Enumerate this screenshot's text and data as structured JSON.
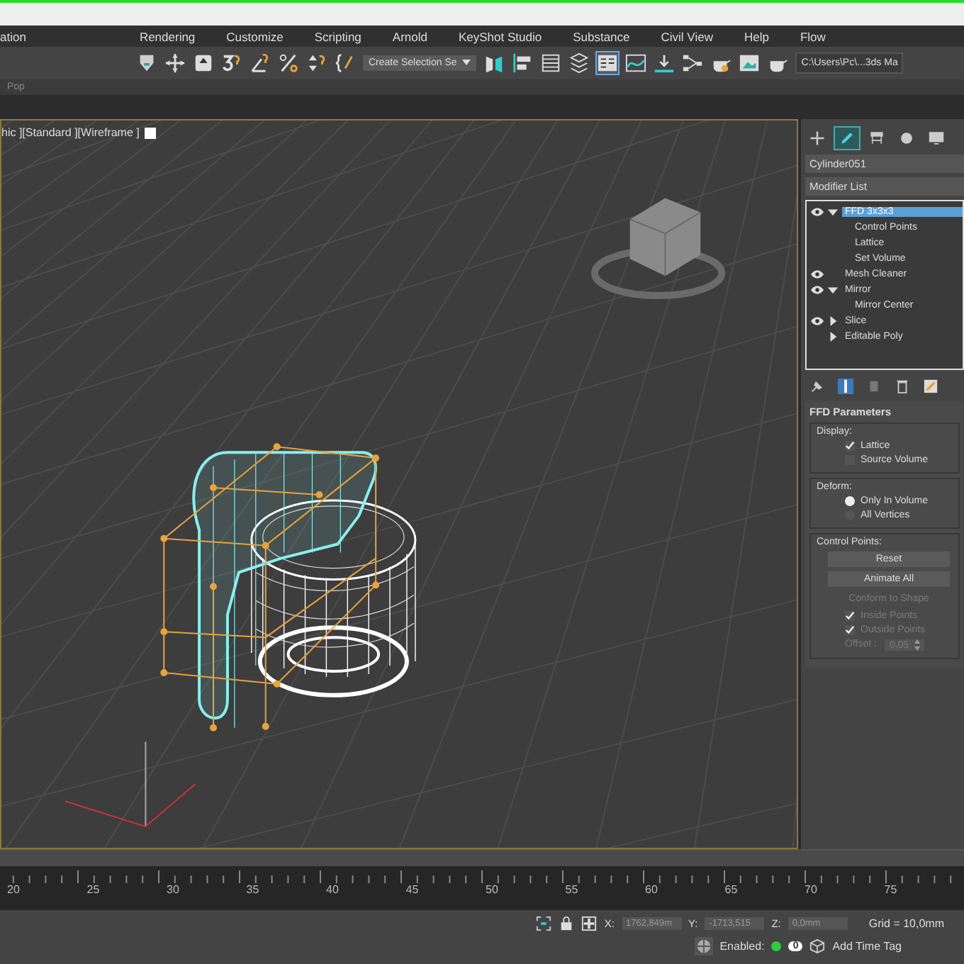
{
  "menu_bar": {
    "items": [
      "ation",
      "Rendering",
      "Customize",
      "Scripting",
      "Arnold",
      "KeyShot Studio",
      "Substance",
      "Civil View",
      "Help",
      "Flow"
    ]
  },
  "toolbar": {
    "selection_set": "Create Selection Se",
    "project_path": "C:\\Users\\Pc\\...3ds Ma"
  },
  "ribbon": {
    "label": "Pop"
  },
  "viewport": {
    "label": "hic ][Standard ][Wireframe ]"
  },
  "command_panel": {
    "tabs": [
      {
        "kind": "create",
        "selected": false
      },
      {
        "kind": "modify",
        "selected": true
      },
      {
        "kind": "hierarchy",
        "selected": false
      },
      {
        "kind": "motion",
        "selected": false
      },
      {
        "kind": "display",
        "selected": false
      }
    ],
    "object_name": "Cylinder051",
    "modifier_list": "Modifier List",
    "stack": [
      {
        "label": "FFD 3x3x3",
        "visible": true,
        "expanded": true,
        "selected": true,
        "children": [
          "Control Points",
          "Lattice",
          "Set Volume"
        ]
      },
      {
        "label": "Mesh Cleaner",
        "visible": true,
        "selected": false
      },
      {
        "label": "Mirror",
        "visible": true,
        "expanded": true,
        "selected": false,
        "children": [
          "Mirror Center"
        ]
      },
      {
        "label": "Slice",
        "visible": true,
        "expanded": false,
        "selected": false
      },
      {
        "label": "Editable Poly",
        "visible": false,
        "expanded": false,
        "selected": false
      }
    ],
    "rollout": {
      "title": "FFD Parameters",
      "groups": [
        {
          "title": "Display:",
          "controls": [
            {
              "kind": "checkbox",
              "label": "Lattice",
              "checked": true
            },
            {
              "kind": "checkbox",
              "label": "Source Volume",
              "checked": false
            }
          ]
        },
        {
          "title": "Deform:",
          "controls": [
            {
              "kind": "radio",
              "label": "Only In Volume",
              "selected": true
            },
            {
              "kind": "radio",
              "label": "All Vertices",
              "selected": false
            }
          ]
        },
        {
          "title": "Control Points:",
          "controls": [
            {
              "kind": "button",
              "label": "Reset",
              "disabled": false
            },
            {
              "kind": "button",
              "label": "Animate All",
              "disabled": false
            },
            {
              "kind": "button",
              "label": "Conform to Shape",
              "disabled": true
            },
            {
              "kind": "checkbox",
              "label": "Inside Points",
              "checked": true,
              "disabled": true
            },
            {
              "kind": "checkbox",
              "label": "Outside Points",
              "checked": true,
              "disabled": true
            },
            {
              "kind": "spinner",
              "label": "Offset :",
              "value": "0,05",
              "disabled": true
            }
          ]
        }
      ]
    }
  },
  "timeline": {
    "labels": [
      "20",
      "25",
      "30",
      "35",
      "40",
      "45",
      "50",
      "55",
      "60",
      "65",
      "70",
      "75"
    ]
  },
  "status_bar": {
    "x_label": "X:",
    "x_value": "1762,849m",
    "y_label": "Y:",
    "y_value": "-1713,515",
    "z_label": "Z:",
    "z_value": "0,0mm",
    "grid": "Grid = 10,0mm",
    "enabled_label": "Enabled:",
    "enabled_on": true,
    "counter": "0",
    "time_tag": "Add Time Tag"
  }
}
